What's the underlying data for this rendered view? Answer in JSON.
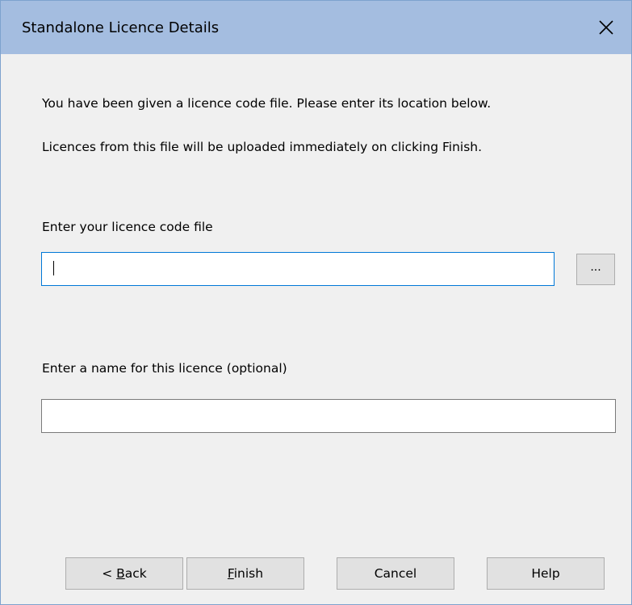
{
  "dialog": {
    "title": "Standalone Licence Details",
    "close_label": "Close"
  },
  "intro": {
    "line1": "You have been given a licence code file. Please enter its location below.",
    "line2": "Licences from this file will be uploaded immediately on clicking Finish."
  },
  "code_file": {
    "label": "Enter your licence code file",
    "value": "",
    "browse_label": "..."
  },
  "licence_name": {
    "label": "Enter a name for this licence (optional)",
    "value": ""
  },
  "buttons": {
    "back_prefix": "< ",
    "back_label": "Back",
    "finish_label": "Finish",
    "cancel_label": "Cancel",
    "help_label": "Help"
  }
}
